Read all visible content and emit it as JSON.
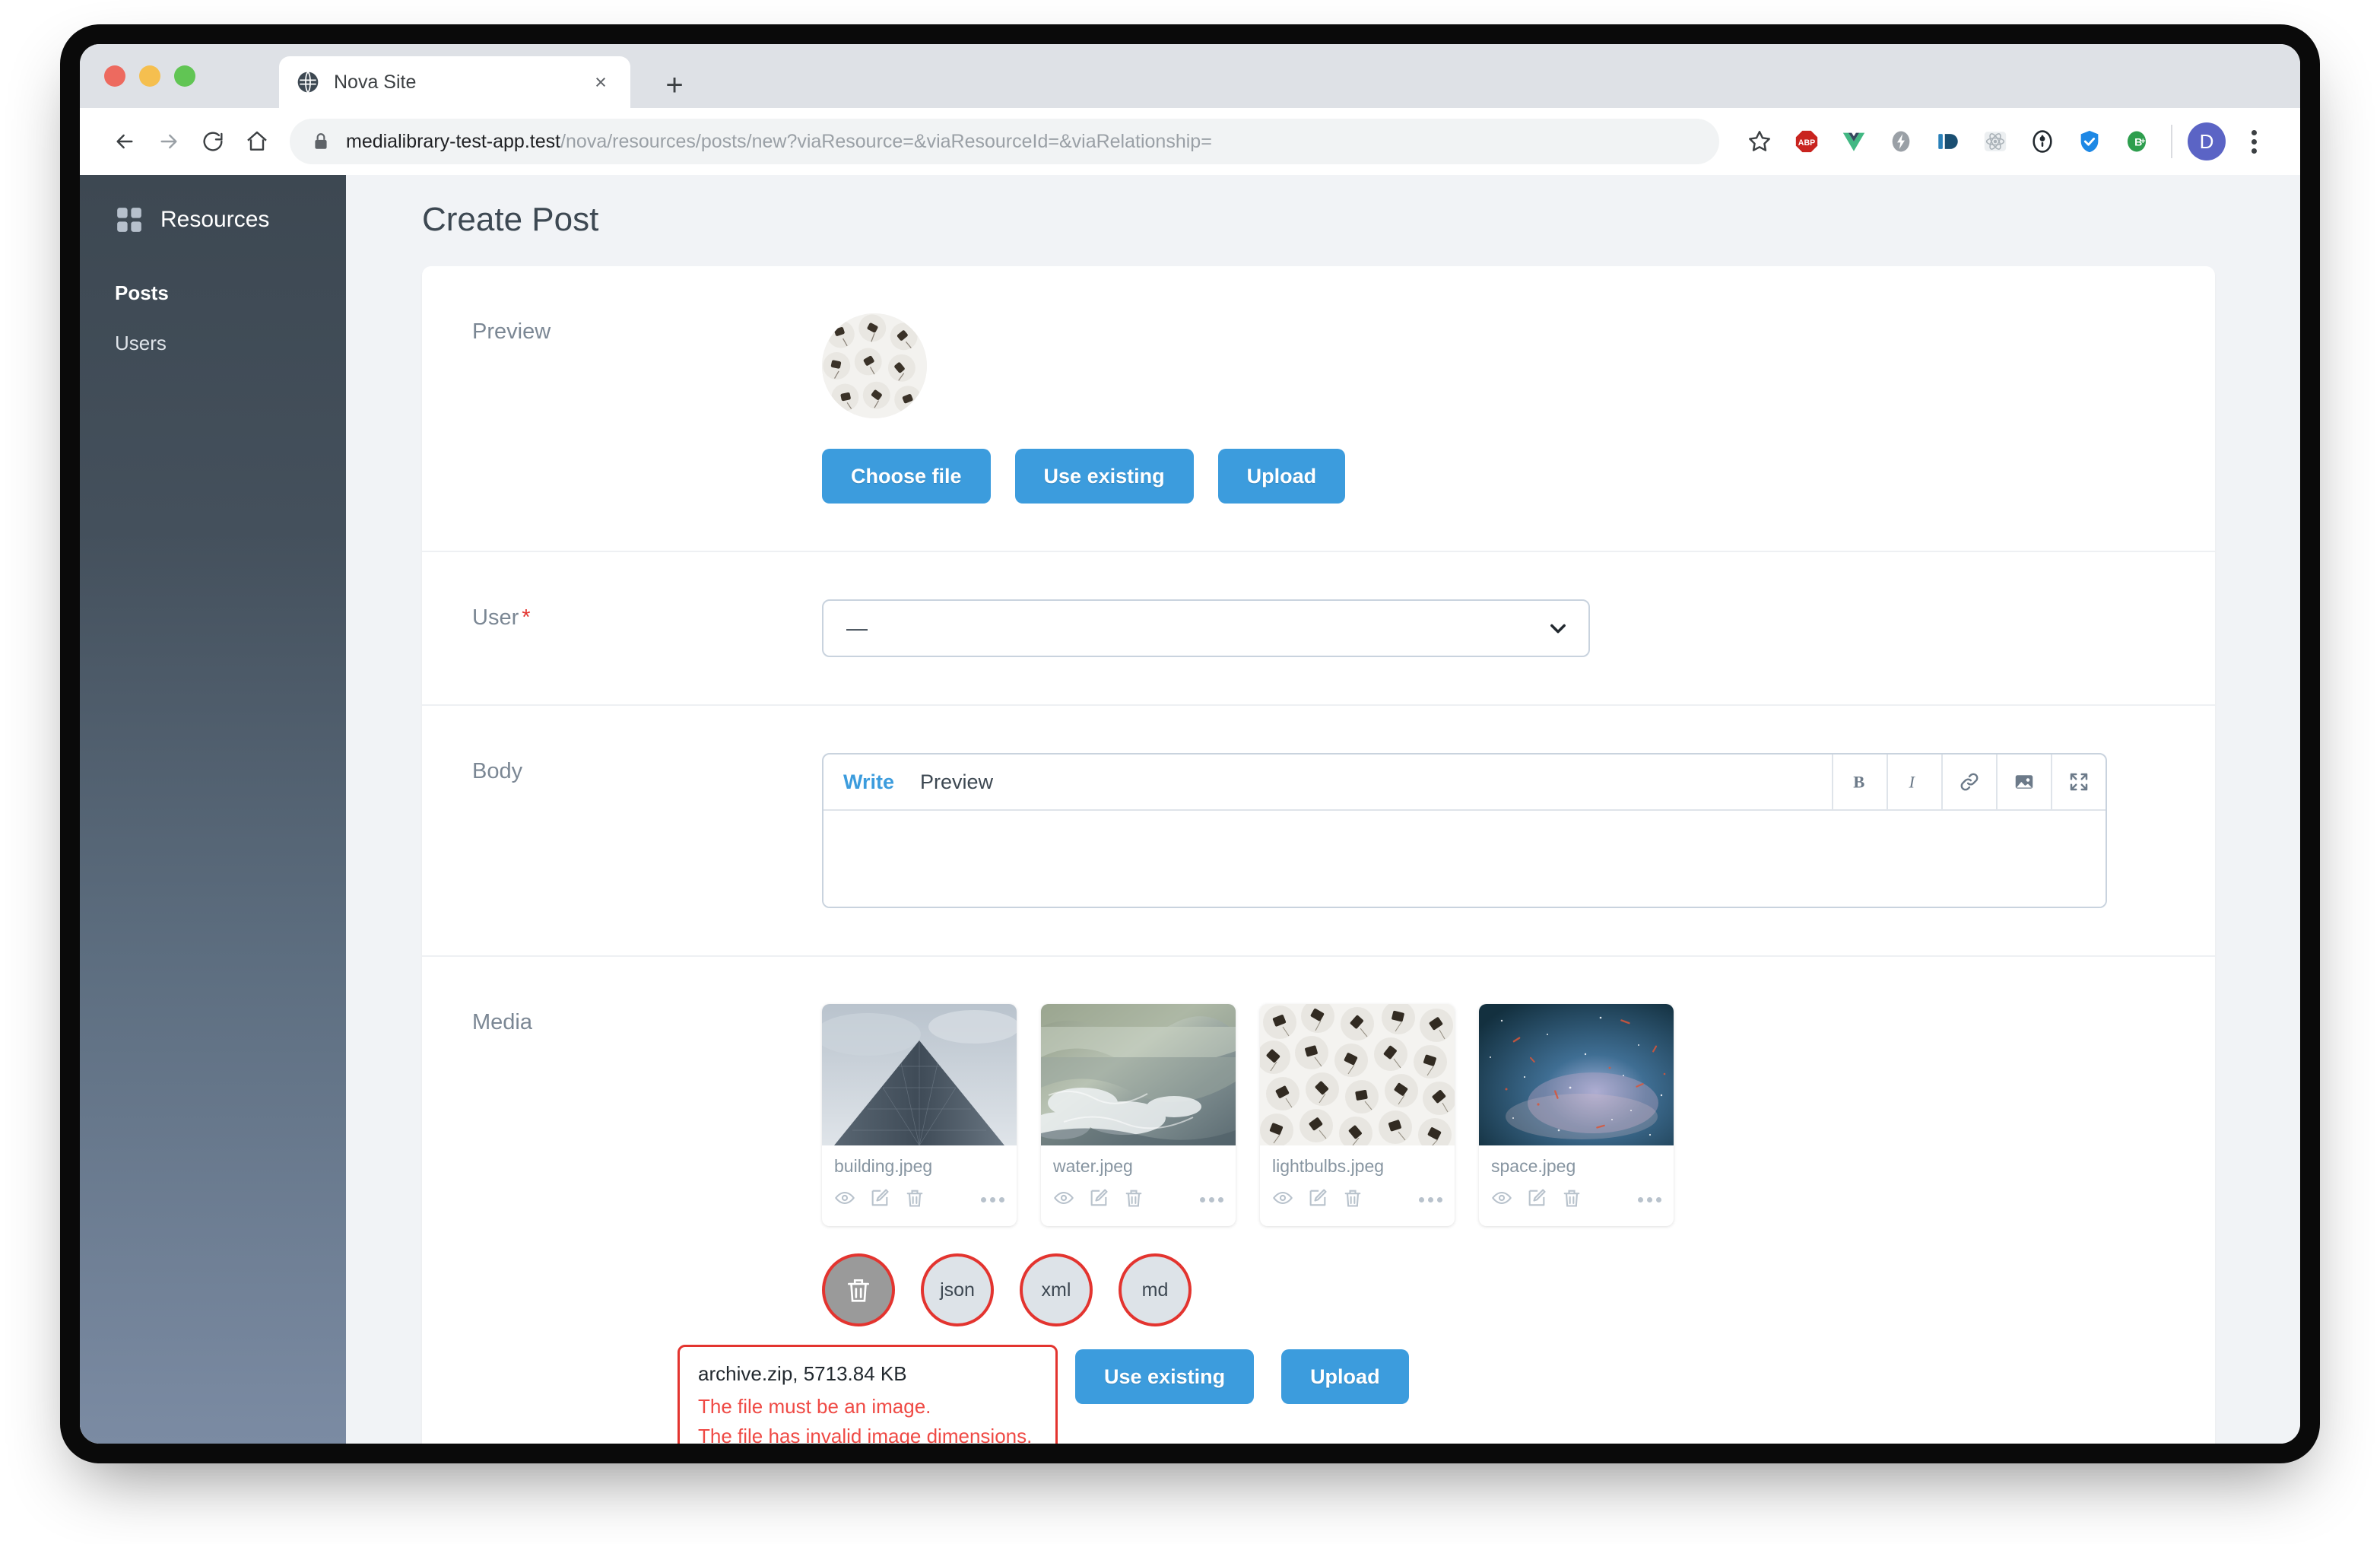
{
  "browser": {
    "tab_title": "Nova Site",
    "tab_close": "×",
    "new_tab": "+",
    "url_domain": "medialibrary-test-app.test",
    "url_path": "/nova/resources/posts/new?viaResource=&viaResourceId=&viaRelationship=",
    "avatar_initial": "D",
    "extensions": [
      "bookmark-star-icon",
      "adblock-plus-icon",
      "vue-devtools-icon",
      "lightning-icon",
      "id-icon",
      "react-devtools-icon",
      "1password-icon",
      "shield-icon",
      "b-plus-icon"
    ]
  },
  "sidebar": {
    "header": "Resources",
    "items": [
      {
        "label": "Posts",
        "active": true
      },
      {
        "label": "Users",
        "active": false
      }
    ]
  },
  "main": {
    "page_title": "Create Post",
    "preview": {
      "label": "Preview",
      "thumbnail": "lightbulbs-circle-thumbnail",
      "buttons": [
        "Choose file",
        "Use existing",
        "Upload"
      ]
    },
    "user": {
      "label": "User",
      "required_marker": "*",
      "selected_value": "—"
    },
    "body": {
      "label": "Body",
      "tabs": [
        {
          "label": "Write",
          "active": true
        },
        {
          "label": "Preview",
          "active": false
        }
      ],
      "tools": [
        "bold-icon",
        "italic-icon",
        "link-icon",
        "image-icon",
        "fullscreen-icon"
      ],
      "content": ""
    },
    "media": {
      "label": "Media",
      "items": [
        {
          "name": "building.jpeg",
          "thumb": "building"
        },
        {
          "name": "water.jpeg",
          "thumb": "water"
        },
        {
          "name": "lightbulbs.jpeg",
          "thumb": "lightbulbs"
        },
        {
          "name": "space.jpeg",
          "thumb": "space"
        }
      ],
      "item_actions": [
        "eye-icon",
        "edit-icon",
        "trash-icon",
        "more-icon"
      ],
      "invalid_chips": [
        {
          "label": "",
          "icon": "trash-icon",
          "hovered": true
        },
        {
          "label": "json",
          "icon": "",
          "hovered": false
        },
        {
          "label": "xml",
          "icon": "",
          "hovered": false
        },
        {
          "label": "md",
          "icon": "",
          "hovered": false
        }
      ],
      "error": {
        "file": "archive.zip, 5713.84 KB",
        "messages": [
          "The file must be an image.",
          "The file has invalid image dimensions."
        ]
      },
      "buttons": [
        "Use existing",
        "Upload"
      ]
    }
  },
  "colors": {
    "accent_blue": "#3c9cdd",
    "error_red": "#e3342f",
    "sidebar_top": "#3d4852",
    "sidebar_bottom": "#7b8ba3",
    "label_gray": "#7b8794"
  }
}
